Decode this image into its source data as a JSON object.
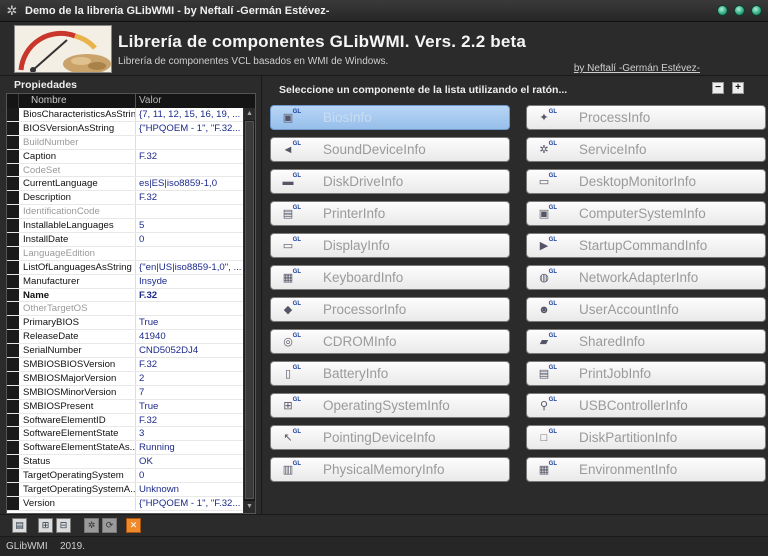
{
  "window": {
    "title": "Demo de la librería GLibWMI - by Neftalí -Germán Estévez-"
  },
  "header": {
    "title": "Librería de componentes GLibWMI.  Vers. 2.2 beta",
    "subtitle": "Librería de componentes VCL basados en WMI de Windows.",
    "author_link": "by Neftalí -Germán Estévez-"
  },
  "properties": {
    "panel_label": "Propiedades",
    "col_name": "Nombre",
    "col_value": "Valor",
    "rows": [
      {
        "name": "BiosCharacteristicsAsString",
        "value": "{7, 11, 12, 15, 16, 19, ..."
      },
      {
        "name": "BIOSVersionAsString",
        "value": "{\"HPQOEM - 1\", \"F.32..."
      },
      {
        "name": "BuildNumber",
        "value": ""
      },
      {
        "name": "Caption",
        "value": "F.32"
      },
      {
        "name": "CodeSet",
        "value": ""
      },
      {
        "name": "CurrentLanguage",
        "value": "es|ES|iso8859-1,0"
      },
      {
        "name": "Description",
        "value": "F.32"
      },
      {
        "name": "IdentificationCode",
        "value": ""
      },
      {
        "name": "InstallableLanguages",
        "value": "5"
      },
      {
        "name": "InstallDate",
        "value": "0"
      },
      {
        "name": "LanguageEdition",
        "value": ""
      },
      {
        "name": "ListOfLanguagesAsString",
        "value": "{\"en|US|iso8859-1,0\", ..."
      },
      {
        "name": "Manufacturer",
        "value": "Insyde"
      },
      {
        "name": "Name",
        "value": "F.32"
      },
      {
        "name": "OtherTargetOS",
        "value": ""
      },
      {
        "name": "PrimaryBIOS",
        "value": "True"
      },
      {
        "name": "ReleaseDate",
        "value": "41940"
      },
      {
        "name": "SerialNumber",
        "value": "CND5052DJ4"
      },
      {
        "name": "SMBIOSBIOSVersion",
        "value": "F.32"
      },
      {
        "name": "SMBIOSMajorVersion",
        "value": "2"
      },
      {
        "name": "SMBIOSMinorVersion",
        "value": "7"
      },
      {
        "name": "SMBIOSPresent",
        "value": "True"
      },
      {
        "name": "SoftwareElementID",
        "value": "F.32"
      },
      {
        "name": "SoftwareElementState",
        "value": "3"
      },
      {
        "name": "SoftwareElementStateAs...",
        "value": "Running"
      },
      {
        "name": "Status",
        "value": "OK"
      },
      {
        "name": "TargetOperatingSystem",
        "value": "0"
      },
      {
        "name": "TargetOperatingSystemA...",
        "value": "Unknown"
      },
      {
        "name": "Version",
        "value": "{\"HPQOEM - 1\", \"F.32..."
      }
    ]
  },
  "components": {
    "instruction": "Seleccione un componente de la lista utilizando el ratón...",
    "collapse_symbol": "−",
    "expand_symbol": "+",
    "left": [
      {
        "label": "BiosInfo",
        "icon": "bios-icon",
        "glyph": "▣",
        "selected": true
      },
      {
        "label": "SoundDeviceInfo",
        "icon": "speaker-icon",
        "glyph": "◄"
      },
      {
        "label": "DiskDriveInfo",
        "icon": "disk-drive-icon",
        "glyph": "▬"
      },
      {
        "label": "PrinterInfo",
        "icon": "printer-icon",
        "glyph": "▤"
      },
      {
        "label": "DisplayInfo",
        "icon": "monitor-icon",
        "glyph": "▭"
      },
      {
        "label": "KeyboardInfo",
        "icon": "keyboard-icon",
        "glyph": "▦"
      },
      {
        "label": "ProcessorInfo",
        "icon": "processor-icon",
        "glyph": "◆"
      },
      {
        "label": "CDROMInfo",
        "icon": "cdrom-icon",
        "glyph": "◎"
      },
      {
        "label": "BatteryInfo",
        "icon": "battery-icon",
        "glyph": "▯"
      },
      {
        "label": "OperatingSystemInfo",
        "icon": "windows-logo-icon",
        "glyph": "⊞"
      },
      {
        "label": "PointingDeviceInfo",
        "icon": "mouse-pointer-icon",
        "glyph": "↖"
      },
      {
        "label": "PhysicalMemoryInfo",
        "icon": "memory-icon",
        "glyph": "▥"
      }
    ],
    "right": [
      {
        "label": "ProcessInfo",
        "icon": "process-icon",
        "glyph": "✦"
      },
      {
        "label": "ServiceInfo",
        "icon": "service-gear-icon",
        "glyph": "✲"
      },
      {
        "label": "DesktopMonitorInfo",
        "icon": "desktop-monitor-icon",
        "glyph": "▭"
      },
      {
        "label": "ComputerSystemInfo",
        "icon": "computer-icon",
        "glyph": "▣"
      },
      {
        "label": "StartupCommandInfo",
        "icon": "startup-icon",
        "glyph": "▶"
      },
      {
        "label": "NetworkAdapterInfo",
        "icon": "network-globe-icon",
        "glyph": "◍"
      },
      {
        "label": "UserAccountInfo",
        "icon": "user-icon",
        "glyph": "☻"
      },
      {
        "label": "SharedInfo",
        "icon": "shared-folder-icon",
        "glyph": "▰"
      },
      {
        "label": "PrintJobInfo",
        "icon": "print-job-icon",
        "glyph": "▤"
      },
      {
        "label": "USBControllerInfo",
        "icon": "usb-icon",
        "glyph": "⚲"
      },
      {
        "label": "DiskPartitionInfo",
        "icon": "disk-partition-icon",
        "glyph": "□"
      },
      {
        "label": "EnvironmentInfo",
        "icon": "environment-icon",
        "glyph": "▦"
      }
    ]
  },
  "toolbar": {
    "buttons": [
      {
        "name": "save-icon",
        "glyph": "▤"
      },
      {
        "name": "expand-all-icon",
        "glyph": "⊞"
      },
      {
        "name": "collapse-all-icon",
        "glyph": "⊟"
      },
      {
        "name": "settings-gear-icon",
        "glyph": "✲"
      },
      {
        "name": "refresh-icon",
        "glyph": "⟳"
      },
      {
        "name": "close-orange-icon",
        "glyph": "✕"
      }
    ]
  },
  "status": {
    "app": "GLibWMI",
    "year": "2019."
  },
  "colors": {
    "background": "#2b2b2b",
    "selected_button": "#a8cbf2",
    "value_text": "#1c2a8c"
  }
}
